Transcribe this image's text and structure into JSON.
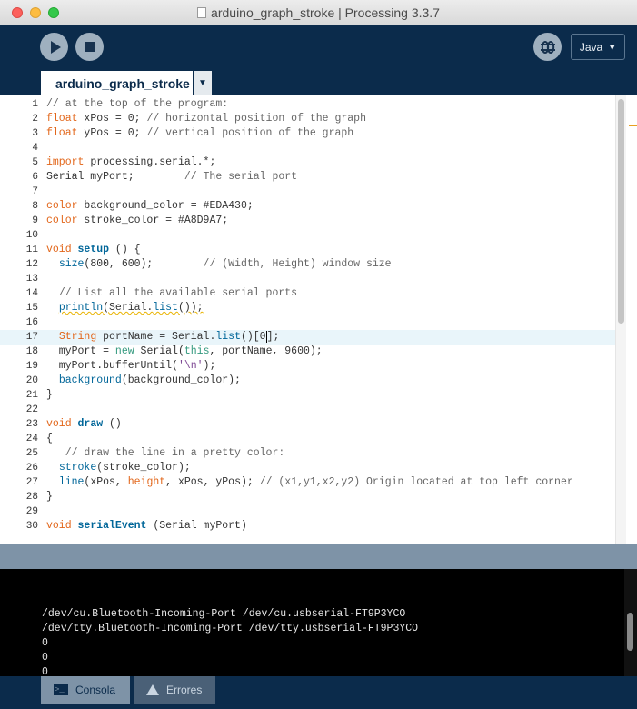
{
  "window": {
    "title": "arduino_graph_stroke | Processing 3.3.7"
  },
  "toolbar": {
    "run_icon": "play-icon",
    "stop_icon": "stop-icon",
    "debug_icon": "debugger-icon",
    "mode_label": "Java",
    "mode_caret": "▼"
  },
  "tabs": {
    "active_label": "arduino_graph_stroke",
    "menu_caret": "▼"
  },
  "editor": {
    "current_line": 17,
    "lines": [
      {
        "n": "1",
        "html": "<span class='cm'>// at the top of the program:</span>"
      },
      {
        "n": "2",
        "html": "<span class='k1'>float</span> xPos = 0; <span class='cm'>// horizontal position of the graph</span>"
      },
      {
        "n": "3",
        "html": "<span class='k1'>float</span> yPos = 0; <span class='cm'>// vertical position of the graph</span>"
      },
      {
        "n": "4",
        "html": ""
      },
      {
        "n": "5",
        "html": "<span class='k1'>import</span> processing.serial.*;"
      },
      {
        "n": "6",
        "html": "Serial myPort;        <span class='cm'>// The serial port</span>"
      },
      {
        "n": "7",
        "html": ""
      },
      {
        "n": "8",
        "html": "<span class='k1'>color</span> background_color = #EDA430;"
      },
      {
        "n": "9",
        "html": "<span class='k1'>color</span> stroke_color = #A8D9A7;"
      },
      {
        "n": "10",
        "html": ""
      },
      {
        "n": "11",
        "html": "<span class='k1'>void</span> <span class='fn'>setup</span> () {"
      },
      {
        "n": "12",
        "html": "  <span class='k3'>size</span>(800, 600);        <span class='cm'>// (Width, Height) window size</span>"
      },
      {
        "n": "13",
        "html": ""
      },
      {
        "n": "14",
        "html": "  <span class='cm'>// List all the available serial ports</span>"
      },
      {
        "n": "15",
        "html": "  <span class='sq'><span class='k3'>println</span>(Serial.<span class='k3'>list</span>());</span>"
      },
      {
        "n": "16",
        "html": ""
      },
      {
        "n": "17",
        "html": "  <span class='k1'>String</span> portName = Serial.<span class='k3'>list</span>()[0<span class='caret'></span>];"
      },
      {
        "n": "18",
        "html": "  myPort = <span class='k2'>new</span> Serial(<span class='k2'>this</span>, portName, 9600);"
      },
      {
        "n": "19",
        "html": "  myPort.bufferUntil(<span class='st'>'\\n'</span>);"
      },
      {
        "n": "20",
        "html": "  <span class='k3'>background</span>(background_color);"
      },
      {
        "n": "21",
        "html": "}"
      },
      {
        "n": "22",
        "html": ""
      },
      {
        "n": "23",
        "html": "<span class='k1'>void</span> <span class='fn'>draw</span> ()"
      },
      {
        "n": "24",
        "html": "{"
      },
      {
        "n": "25",
        "html": "   <span class='cm'>// draw the line in a pretty color:</span>"
      },
      {
        "n": "26",
        "html": "  <span class='k3'>stroke</span>(stroke_color);"
      },
      {
        "n": "27",
        "html": "  <span class='k3'>line</span>(xPos, <span class='k1'>height</span>, xPos, yPos); <span class='cm'>// (x1,y1,x2,y2) Origin located at top left corner</span>"
      },
      {
        "n": "28",
        "html": "}"
      },
      {
        "n": "29",
        "html": ""
      },
      {
        "n": "30",
        "html": "<span class='k1'>void</span> <span class='fn'>serialEvent</span> (Serial myPort)"
      }
    ]
  },
  "console": {
    "lines": [
      "/dev/cu.Bluetooth-Incoming-Port /dev/cu.usbserial-FT9P3YCO",
      "/dev/tty.Bluetooth-Incoming-Port /dev/tty.usbserial-FT9P3YCO",
      "0",
      "0",
      "0"
    ]
  },
  "bottom_tabs": {
    "console_label": "Consola",
    "errors_label": "Errores",
    "console_icon": "console-icon",
    "errors_icon": "warning-icon"
  },
  "colors": {
    "chrome": "#0b2b4b",
    "button": "#9fb0bf",
    "divider": "#7e93a7",
    "keyword": "#e2661a",
    "function": "#006699",
    "comment": "#666666"
  }
}
